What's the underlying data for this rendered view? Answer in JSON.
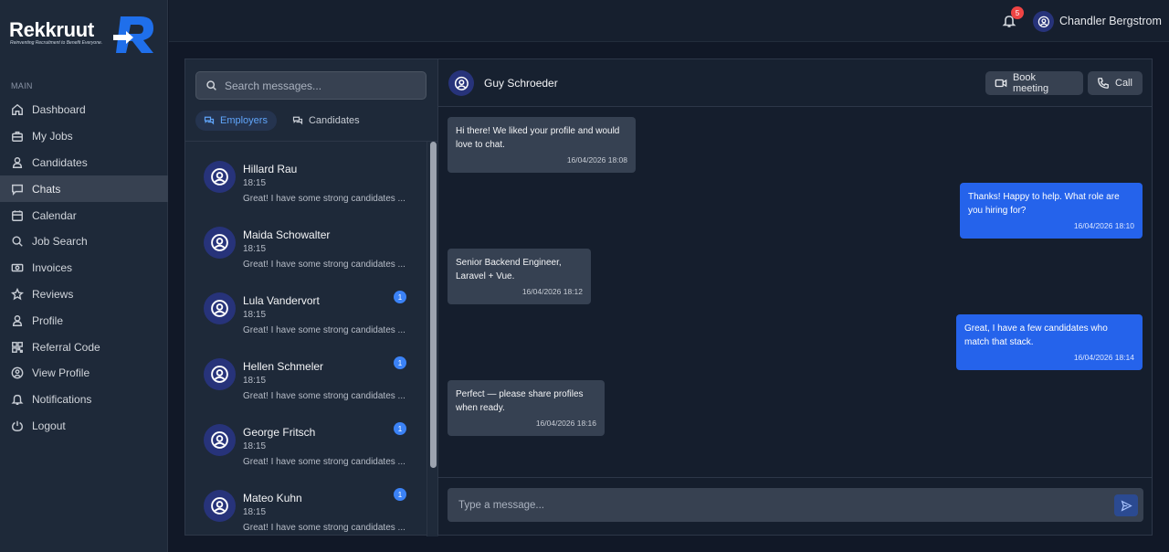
{
  "brand": {
    "name": "Rekkruut",
    "tagline": "Reinventing Recruitment to Benefit Everyone.",
    "primary_color": "#1f6feb"
  },
  "sidebar": {
    "caption": "MAIN",
    "items": [
      {
        "label": "Dashboard",
        "icon": "home-icon"
      },
      {
        "label": "My Jobs",
        "icon": "briefcase-icon"
      },
      {
        "label": "Candidates",
        "icon": "user-icon"
      },
      {
        "label": "Chats",
        "icon": "chat-bubble-icon",
        "active": true
      },
      {
        "label": "Calendar",
        "icon": "calendar-icon"
      },
      {
        "label": "Job Search",
        "icon": "search-icon"
      },
      {
        "label": "Invoices",
        "icon": "money-icon"
      },
      {
        "label": "Reviews",
        "icon": "star-icon"
      },
      {
        "label": "Profile",
        "icon": "user-icon"
      },
      {
        "label": "Referral Code",
        "icon": "qr-code-icon"
      },
      {
        "label": "View Profile",
        "icon": "user-circle-icon"
      },
      {
        "label": "Notifications",
        "icon": "bell-icon"
      },
      {
        "label": "Logout",
        "icon": "logout-icon"
      }
    ]
  },
  "topbar": {
    "notification_count": "5",
    "user_name": "Chandler Bergstrom"
  },
  "conversations": {
    "search_placeholder": "Search messages...",
    "tabs": [
      {
        "label": "Employers",
        "active": true
      },
      {
        "label": "Candidates",
        "active": false
      }
    ],
    "items": [
      {
        "name": "Hillard Rau",
        "time": "18:15",
        "preview": "Great! I have some strong candidates ...",
        "unread": ""
      },
      {
        "name": "Maida Schowalter",
        "time": "18:15",
        "preview": "Great! I have some strong candidates ...",
        "unread": ""
      },
      {
        "name": "Lula Vandervort",
        "time": "18:15",
        "preview": "Great! I have some strong candidates ...",
        "unread": "1"
      },
      {
        "name": "Hellen Schmeler",
        "time": "18:15",
        "preview": "Great! I have some strong candidates ...",
        "unread": "1"
      },
      {
        "name": "George Fritsch",
        "time": "18:15",
        "preview": "Great! I have some strong candidates ...",
        "unread": "1"
      },
      {
        "name": "Mateo Kuhn",
        "time": "18:15",
        "preview": "Great! I have some strong candidates ...",
        "unread": "1"
      }
    ]
  },
  "chat": {
    "contact_name": "Guy Schroeder",
    "book_meeting_label": "Book meeting",
    "call_label": "Call",
    "messages": [
      {
        "direction": "in",
        "text": "Hi there! We liked your profile and would love to chat.",
        "timestamp": "16/04/2026 18:08"
      },
      {
        "direction": "out",
        "text": "Thanks! Happy to help. What role are you hiring for?",
        "timestamp": "16/04/2026 18:10"
      },
      {
        "direction": "in",
        "text": "Senior Backend Engineer, Laravel + Vue.",
        "timestamp": "16/04/2026 18:12"
      },
      {
        "direction": "out",
        "text": "Great, I have a few candidates who match that stack.",
        "timestamp": "16/04/2026 18:14"
      },
      {
        "direction": "in",
        "text": "Perfect — please share profiles when ready.",
        "timestamp": "16/04/2026 18:16"
      }
    ],
    "composer_placeholder": "Type a message..."
  }
}
